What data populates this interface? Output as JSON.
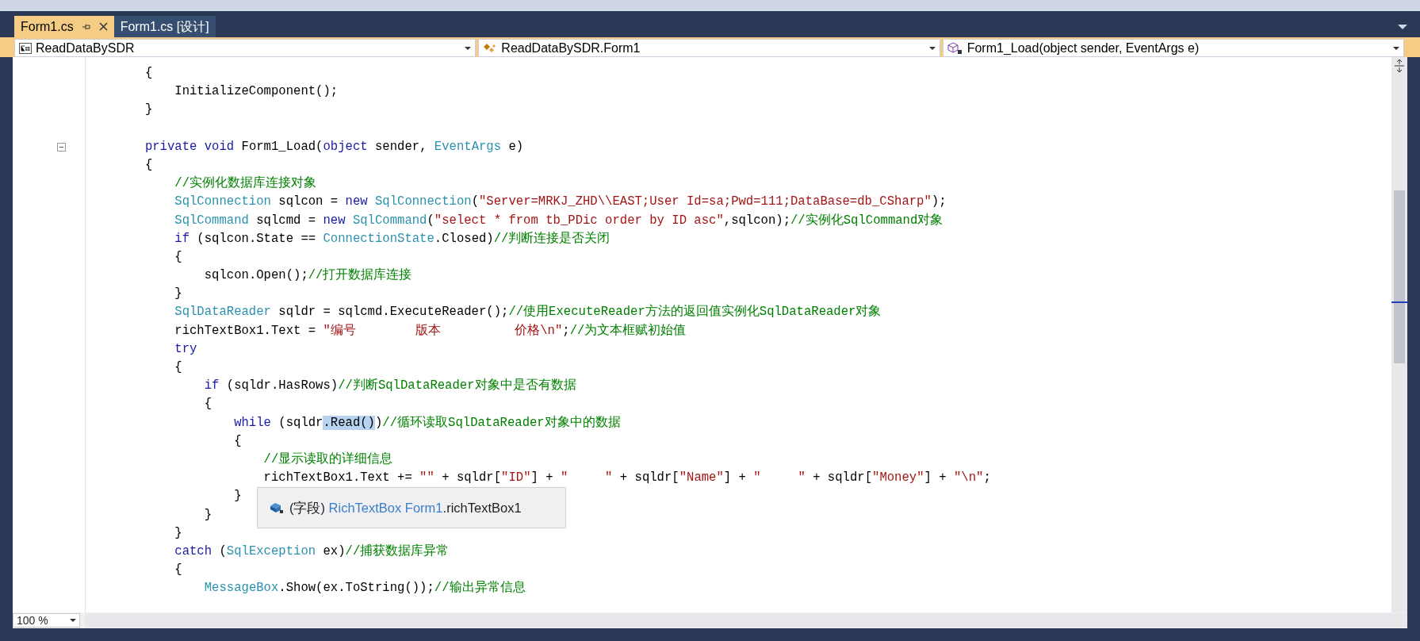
{
  "tabs": [
    {
      "label": "Form1.cs",
      "selected": true
    },
    {
      "label": "Form1.cs [设计]",
      "selected": false
    }
  ],
  "nav_bar": [
    {
      "kind": "project",
      "text": "ReadDataBySDR"
    },
    {
      "kind": "class",
      "text": "ReadDataBySDR.Form1"
    },
    {
      "kind": "method",
      "text": "Form1_Load(object sender, EventArgs e)"
    }
  ],
  "editor": {
    "lines": [
      {
        "foldable": false,
        "tokens": [
          {
            "kind": "plain",
            "text": "        {"
          }
        ]
      },
      {
        "foldable": false,
        "tokens": [
          {
            "kind": "plain",
            "text": "            InitializeComponent();"
          }
        ]
      },
      {
        "foldable": false,
        "tokens": [
          {
            "kind": "plain",
            "text": "        }"
          }
        ]
      },
      {
        "foldable": false
      },
      {
        "foldable": true,
        "tokens": [
          {
            "kind": "kw",
            "text": "        private void "
          },
          {
            "kind": "plain",
            "text": "Form1_Load("
          },
          {
            "kind": "kw",
            "text": "object"
          },
          {
            "kind": "plain",
            "text": " sender, "
          },
          {
            "kind": "type",
            "text": "EventArgs"
          },
          {
            "kind": "plain",
            "text": " e)"
          }
        ]
      },
      {
        "foldable": false,
        "tokens": [
          {
            "kind": "plain",
            "text": "        {"
          }
        ]
      },
      {
        "foldable": false,
        "tokens": [
          {
            "kind": "comment",
            "text": "            //实例化数据库连接对象"
          }
        ]
      },
      {
        "foldable": false,
        "tokens": [
          {
            "kind": "type",
            "text": "            SqlConnection"
          },
          {
            "kind": "plain",
            "text": " sqlcon = "
          },
          {
            "kind": "kw",
            "text": "new "
          },
          {
            "kind": "type",
            "text": "SqlConnection"
          },
          {
            "kind": "plain",
            "text": "("
          },
          {
            "kind": "str",
            "text": "\"Server=MRKJ_ZHD\\\\EAST;User Id=sa;Pwd=111;DataBase=db_CSharp\""
          },
          {
            "kind": "plain",
            "text": ");"
          }
        ]
      },
      {
        "foldable": false,
        "tokens": [
          {
            "kind": "type",
            "text": "            SqlCommand"
          },
          {
            "kind": "plain",
            "text": " sqlcmd = "
          },
          {
            "kind": "kw",
            "text": "new "
          },
          {
            "kind": "type",
            "text": "SqlCommand"
          },
          {
            "kind": "plain",
            "text": "("
          },
          {
            "kind": "str",
            "text": "\"select * from tb_PDic order by ID asc\""
          },
          {
            "kind": "plain",
            "text": ",sqlcon);"
          },
          {
            "kind": "comment",
            "text": "//实例化SqlCommand对象"
          }
        ]
      },
      {
        "foldable": false,
        "tokens": [
          {
            "kind": "kw",
            "text": "            if"
          },
          {
            "kind": "plain",
            "text": " (sqlcon.State == "
          },
          {
            "kind": "type",
            "text": "ConnectionState"
          },
          {
            "kind": "plain",
            "text": ".Closed)"
          },
          {
            "kind": "comment",
            "text": "//判断连接是否关闭"
          }
        ]
      },
      {
        "foldable": false,
        "tokens": [
          {
            "kind": "plain",
            "text": "            {"
          }
        ]
      },
      {
        "foldable": false,
        "tokens": [
          {
            "kind": "plain",
            "text": "                sqlcon.Open();"
          },
          {
            "kind": "comment",
            "text": "//打开数据库连接"
          }
        ]
      },
      {
        "foldable": false,
        "tokens": [
          {
            "kind": "plain",
            "text": "            }"
          }
        ]
      },
      {
        "foldable": false,
        "tokens": [
          {
            "kind": "type",
            "text": "            SqlDataReader"
          },
          {
            "kind": "plain",
            "text": " sqldr = sqlcmd.ExecuteReader();"
          },
          {
            "kind": "comment",
            "text": "//使用ExecuteReader方法的返回值实例化SqlDataReader对象"
          }
        ]
      },
      {
        "foldable": false,
        "tokens": [
          {
            "kind": "plain",
            "text": "            richTextBox1.Text = "
          },
          {
            "kind": "str",
            "text": "\"编号        版本          价格\\n\""
          },
          {
            "kind": "plain",
            "text": ";"
          },
          {
            "kind": "comment",
            "text": "//为文本框赋初始值"
          }
        ]
      },
      {
        "foldable": false,
        "tokens": [
          {
            "kind": "kw",
            "text": "            try"
          }
        ]
      },
      {
        "foldable": false,
        "tokens": [
          {
            "kind": "plain",
            "text": "            {"
          }
        ]
      },
      {
        "foldable": false,
        "tokens": [
          {
            "kind": "kw",
            "text": "                if"
          },
          {
            "kind": "plain",
            "text": " (sqldr.HasRows)"
          },
          {
            "kind": "comment",
            "text": "//判断SqlDataReader对象中是否有数据"
          }
        ]
      },
      {
        "foldable": false,
        "tokens": [
          {
            "kind": "plain",
            "text": "                {"
          }
        ]
      },
      {
        "foldable": false,
        "tokens": [
          {
            "kind": "kw",
            "text": "                    while"
          },
          {
            "kind": "plain",
            "text": " (sqldr"
          },
          {
            "kind": "sel",
            "text": ".Read()"
          },
          {
            "kind": "plain",
            "text": ")"
          },
          {
            "kind": "comment",
            "text": "//循环读取SqlDataReader对象中的数据"
          }
        ]
      },
      {
        "foldable": false,
        "tokens": [
          {
            "kind": "plain",
            "text": "                    {"
          }
        ]
      },
      {
        "foldable": false,
        "tokens": [
          {
            "kind": "comment",
            "text": "                        //显示读取的详细信息"
          }
        ]
      },
      {
        "foldable": false,
        "tokens": [
          {
            "kind": "plain",
            "text": "                        richTextBox1.Text += "
          },
          {
            "kind": "str",
            "text": "\"\""
          },
          {
            "kind": "plain",
            "text": " + sqldr["
          },
          {
            "kind": "str",
            "text": "\"ID\""
          },
          {
            "kind": "plain",
            "text": "] + "
          },
          {
            "kind": "str",
            "text": "\"     \""
          },
          {
            "kind": "plain",
            "text": " + sqldr["
          },
          {
            "kind": "str",
            "text": "\"Name\""
          },
          {
            "kind": "plain",
            "text": "] + "
          },
          {
            "kind": "str",
            "text": "\"     \""
          },
          {
            "kind": "plain",
            "text": " + sqldr["
          },
          {
            "kind": "str",
            "text": "\"Money\""
          },
          {
            "kind": "plain",
            "text": "] + "
          },
          {
            "kind": "str",
            "text": "\"\\n\""
          },
          {
            "kind": "plain",
            "text": ";"
          }
        ]
      },
      {
        "foldable": false,
        "tokens": [
          {
            "kind": "plain",
            "text": "                    }"
          }
        ]
      },
      {
        "foldable": false,
        "tokens": [
          {
            "kind": "plain",
            "text": "                }"
          }
        ]
      },
      {
        "foldable": false,
        "tokens": [
          {
            "kind": "plain",
            "text": "            }"
          }
        ]
      },
      {
        "foldable": false,
        "tokens": [
          {
            "kind": "kw",
            "text": "            catch"
          },
          {
            "kind": "plain",
            "text": " ("
          },
          {
            "kind": "type",
            "text": "SqlException"
          },
          {
            "kind": "plain",
            "text": " ex)"
          },
          {
            "kind": "comment",
            "text": "//捕获数据库异常"
          }
        ]
      },
      {
        "foldable": false,
        "tokens": [
          {
            "kind": "plain",
            "text": "            {"
          }
        ]
      },
      {
        "foldable": false,
        "tokens": [
          {
            "kind": "type",
            "text": "                MessageBox"
          },
          {
            "kind": "plain",
            "text": ".Show(ex.ToString());"
          },
          {
            "kind": "comment",
            "text": "//输出异常信息"
          }
        ]
      }
    ]
  },
  "tooltip": {
    "parts": [
      {
        "kind": "plain",
        "text": "(字段) "
      },
      {
        "kind": "link",
        "text": "RichTextBox Form1"
      },
      {
        "kind": "plain",
        "text": ".richTextBox1"
      }
    ]
  },
  "zoom": "100 %"
}
